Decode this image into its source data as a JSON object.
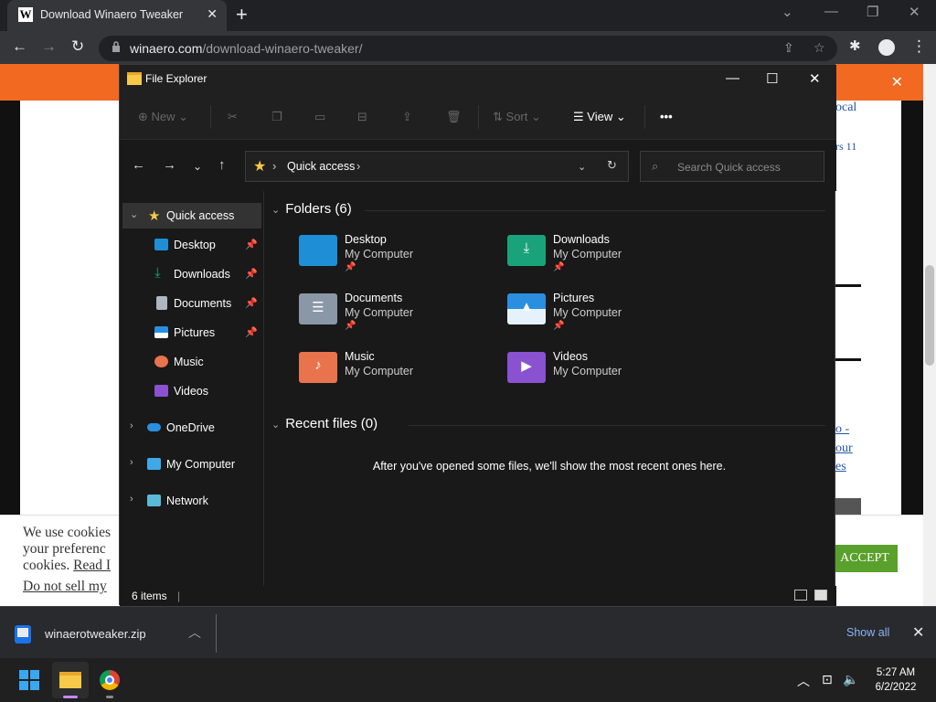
{
  "browser": {
    "tab_title": "Download Winaero Tweaker",
    "tab_favicon": "W",
    "url_domain": "winaero.com",
    "url_path": "/download-winaero-tweaker/"
  },
  "page": {
    "right_snippets": [
      "ocal",
      "rs 11",
      "o -",
      "our",
      "es"
    ],
    "cookie_line1": "We use cookies",
    "cookie_line2": "your preferenc",
    "cookie_line3a": "cookies. ",
    "cookie_line3b": "Read I",
    "cookie_line4": "Do not sell my",
    "accept_label": "ACCEPT"
  },
  "explorer": {
    "title": "File Explorer",
    "toolbar": {
      "new_label": "New",
      "sort_label": "Sort",
      "view_label": "View",
      "more_label": "•••"
    },
    "address": {
      "location": "Quick access"
    },
    "search_placeholder": "Search Quick access",
    "sidebar": [
      {
        "label": "Quick access",
        "icon": "star-icon",
        "pinned": false
      },
      {
        "label": "Desktop",
        "icon": "desktop-icon",
        "pinned": true
      },
      {
        "label": "Downloads",
        "icon": "download-icon",
        "pinned": true
      },
      {
        "label": "Documents",
        "icon": "documents-icon",
        "pinned": true
      },
      {
        "label": "Pictures",
        "icon": "pictures-icon",
        "pinned": true
      },
      {
        "label": "Music",
        "icon": "music-icon",
        "pinned": false
      },
      {
        "label": "Videos",
        "icon": "videos-icon",
        "pinned": false
      },
      {
        "label": "OneDrive",
        "icon": "cloud-icon",
        "pinned": false
      },
      {
        "label": "My Computer",
        "icon": "computer-icon",
        "pinned": false
      },
      {
        "label": "Network",
        "icon": "network-icon",
        "pinned": false
      }
    ],
    "folders_header": "Folders (6)",
    "folders": [
      {
        "name": "Desktop",
        "location": "My Computer",
        "pinned": true,
        "color": "#1e8fd6"
      },
      {
        "name": "Downloads",
        "location": "My Computer",
        "pinned": true,
        "color": "#1aa37a"
      },
      {
        "name": "Documents",
        "location": "My Computer",
        "pinned": true,
        "color": "#8a97a6"
      },
      {
        "name": "Pictures",
        "location": "My Computer",
        "pinned": true,
        "color": "#2a8fe0"
      },
      {
        "name": "Music",
        "location": "My Computer",
        "pinned": false,
        "color": "#e8734d"
      },
      {
        "name": "Videos",
        "location": "My Computer",
        "pinned": false,
        "color": "#8a52d1"
      }
    ],
    "recent_header": "Recent files (0)",
    "recent_empty": "After you've opened some files, we'll show the most recent ones here.",
    "status_items": "6 items"
  },
  "downloads": {
    "file_name": "winaerotweaker.zip",
    "show_all": "Show all"
  },
  "taskbar": {
    "time": "5:27 AM",
    "date": "6/2/2022"
  }
}
